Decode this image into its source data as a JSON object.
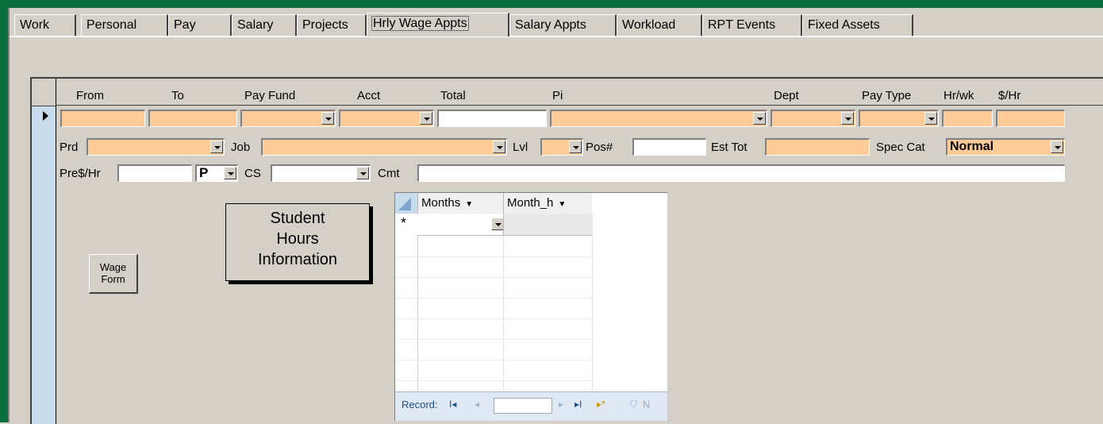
{
  "tabs": [
    {
      "label": "Work"
    },
    {
      "label": "Personal"
    },
    {
      "label": "Pay"
    },
    {
      "label": "Salary"
    },
    {
      "label": "Projects"
    },
    {
      "label": "Hrly Wage Appts",
      "active": true
    },
    {
      "label": "Salary Appts"
    },
    {
      "label": "Workload"
    },
    {
      "label": "RPT Events"
    },
    {
      "label": "Fixed Assets"
    }
  ],
  "columns": {
    "from": "From",
    "to": "To",
    "pay_fund": "Pay Fund",
    "acct": "Acct",
    "total": "Total",
    "pi": "Pi",
    "dept": "Dept",
    "pay_type": "Pay Type",
    "hr_wk": "Hr/wk",
    "rate": "$/Hr"
  },
  "row2": {
    "prd": "Prd",
    "job": "Job",
    "lvl": "Lvl",
    "pos": "Pos#",
    "est_tot": "Est Tot",
    "spec_cat": "Spec Cat",
    "spec_cat_value": "Normal"
  },
  "row3": {
    "pre_rate": "Pre$/Hr",
    "p_value": "P",
    "cs": "CS",
    "cmt": "Cmt"
  },
  "student_box": {
    "line1": "Student",
    "line2": "Hours",
    "line3": "Information"
  },
  "wage_button": {
    "line1": "Wage",
    "line2": "Form"
  },
  "subform": {
    "col1": "Months",
    "col2": "Month_h",
    "new_row_marker": "*",
    "nav_label": "Record:",
    "nav_first": "I◂",
    "nav_prev": "◂",
    "nav_next": "▸",
    "nav_last": "▸I",
    "nav_new": "▸*",
    "nav_filter": "N"
  },
  "colors": {
    "required_field": "#ffcc99",
    "frame_green": "#0a6e3c",
    "background": "#d4d0c8"
  }
}
